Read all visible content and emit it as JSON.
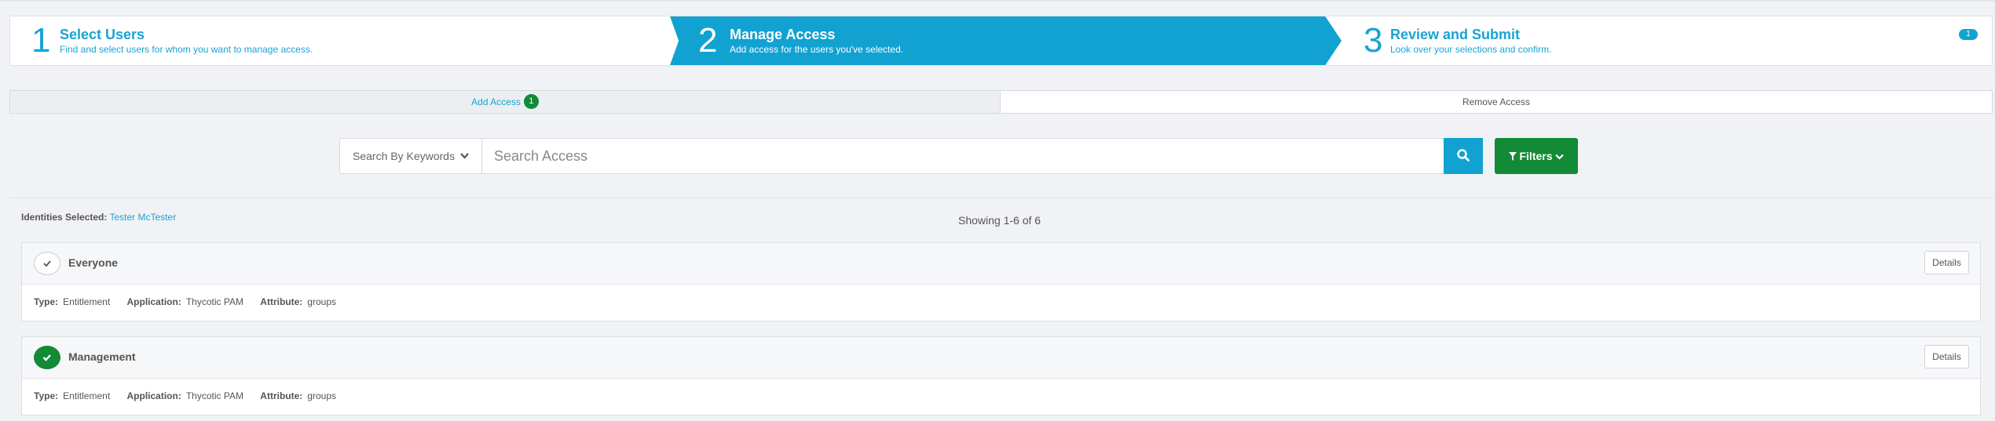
{
  "wizard": {
    "steps": [
      {
        "number": "1",
        "title": "Select Users",
        "description": "Find and select users for whom you want to manage access."
      },
      {
        "number": "2",
        "title": "Manage Access",
        "description": "Add access for the users you've selected."
      },
      {
        "number": "3",
        "title": "Review and Submit",
        "description": "Look over your selections and confirm."
      }
    ],
    "active_step": 2,
    "cart_count": "1"
  },
  "tabs": {
    "add": {
      "label": "Add Access",
      "badge": "1"
    },
    "remove": {
      "label": "Remove Access"
    }
  },
  "search": {
    "mode_label": "Search By Keywords",
    "placeholder": "Search Access",
    "value": "",
    "filters_label": "Filters"
  },
  "identities": {
    "label": "Identities Selected:",
    "value": "Tester McTester"
  },
  "results": {
    "showing": "Showing 1-6 of 6"
  },
  "fields": {
    "type": "Type:",
    "application": "Application:",
    "attribute": "Attribute:",
    "details": "Details"
  },
  "items": [
    {
      "name": "Everyone",
      "selected": false,
      "type": "Entitlement",
      "application": "Thycotic PAM",
      "attribute": "groups"
    },
    {
      "name": "Management",
      "selected": true,
      "type": "Entitlement",
      "application": "Thycotic PAM",
      "attribute": "groups"
    }
  ],
  "colors": {
    "accent": "#12a2d2",
    "success": "#138a36",
    "background": "#f1f2f5"
  },
  "icons": [
    "check-icon",
    "chevron-down-icon",
    "search-icon",
    "filter-icon"
  ]
}
